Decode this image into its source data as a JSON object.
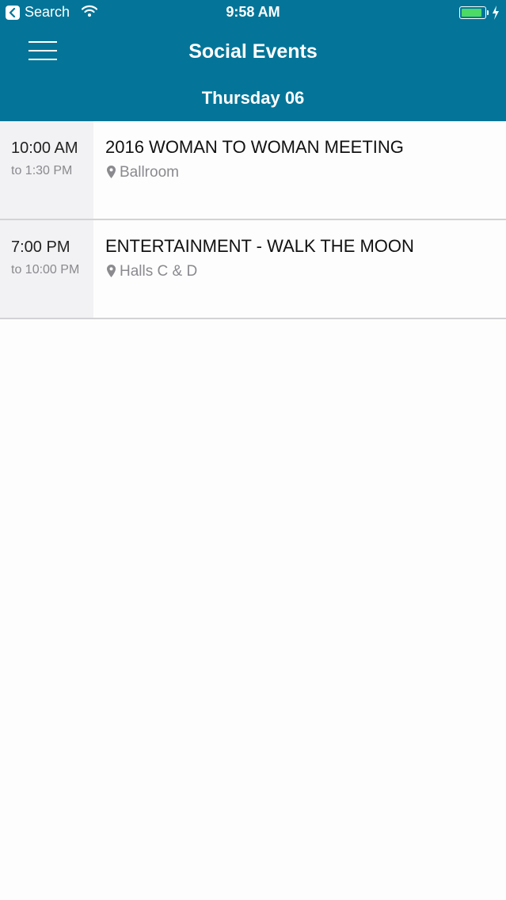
{
  "status_bar": {
    "back_label": "Search",
    "time": "9:58 AM",
    "battery_level": 0.92,
    "icons": [
      "back-arrow-icon",
      "wifi-icon",
      "battery-icon",
      "charging-bolt-icon"
    ]
  },
  "header": {
    "title": "Social Events",
    "day": "Thursday 06",
    "menu_icon": "hamburger-menu-icon"
  },
  "events": [
    {
      "start": "10:00 AM",
      "end": "to 1:30 PM",
      "title": "2016 WOMAN TO WOMAN MEETING",
      "location": "Ballroom"
    },
    {
      "start": "7:00 PM",
      "end": "to 10:00 PM",
      "title": "ENTERTAINMENT - WALK THE MOON",
      "location": "Halls C & D"
    }
  ],
  "colors": {
    "header_bg": "#047598",
    "time_column_bg": "#f2f2f4",
    "secondary_text": "#8a8a8f",
    "battery_fill": "#4cd964"
  }
}
